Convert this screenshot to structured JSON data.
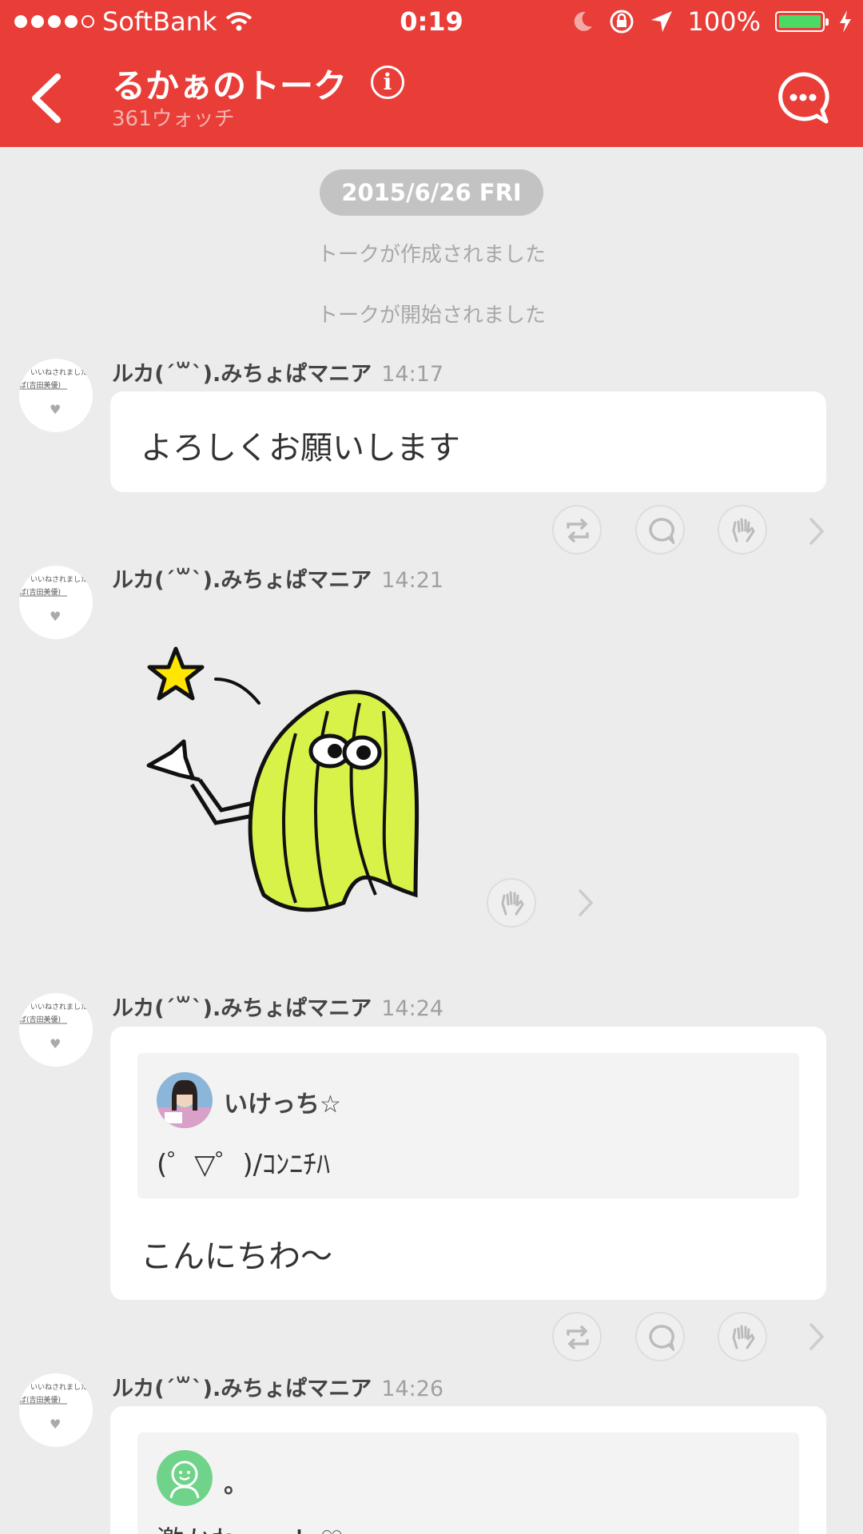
{
  "status": {
    "carrier": "SoftBank",
    "time": "0:19",
    "battery": "100%",
    "battery_level": 1.0
  },
  "header": {
    "title": "るかぁのトーク",
    "info_glyph": "i",
    "watch_count": "361ウォッチ"
  },
  "date_pill": "2015/6/26 FRI",
  "system_messages": [
    "トークが作成されました",
    "トークが開始されました"
  ],
  "avatar_text": {
    "line1": "いいねされました",
    "line2": "ば(吉田美優)"
  },
  "messages": [
    {
      "name": "ルカ(ˊ꒳ˋ).みちょぱマニア",
      "time": "14:17",
      "text": "よろしくお願いします"
    },
    {
      "name": "ルカ(ˊ꒳ˋ).みちょぱマニア",
      "time": "14:21",
      "type": "sticker"
    },
    {
      "name": "ルカ(ˊ꒳ˋ).みちょぱマニア",
      "time": "14:24",
      "quote_name": "いけっち☆",
      "quote_text": "(゜▽゜)/ｺﾝﾆﾁﾊ",
      "text": "こんにちわ〜"
    },
    {
      "name": "ルカ(ˊ꒳ˋ).みちょぱマニア",
      "time": "14:26",
      "quote_name": "。",
      "quote_text": "激かわーー！♡"
    }
  ],
  "colors": {
    "header": "#e93d38",
    "background": "#ececec",
    "sticker_hair": "#d8f24a"
  }
}
